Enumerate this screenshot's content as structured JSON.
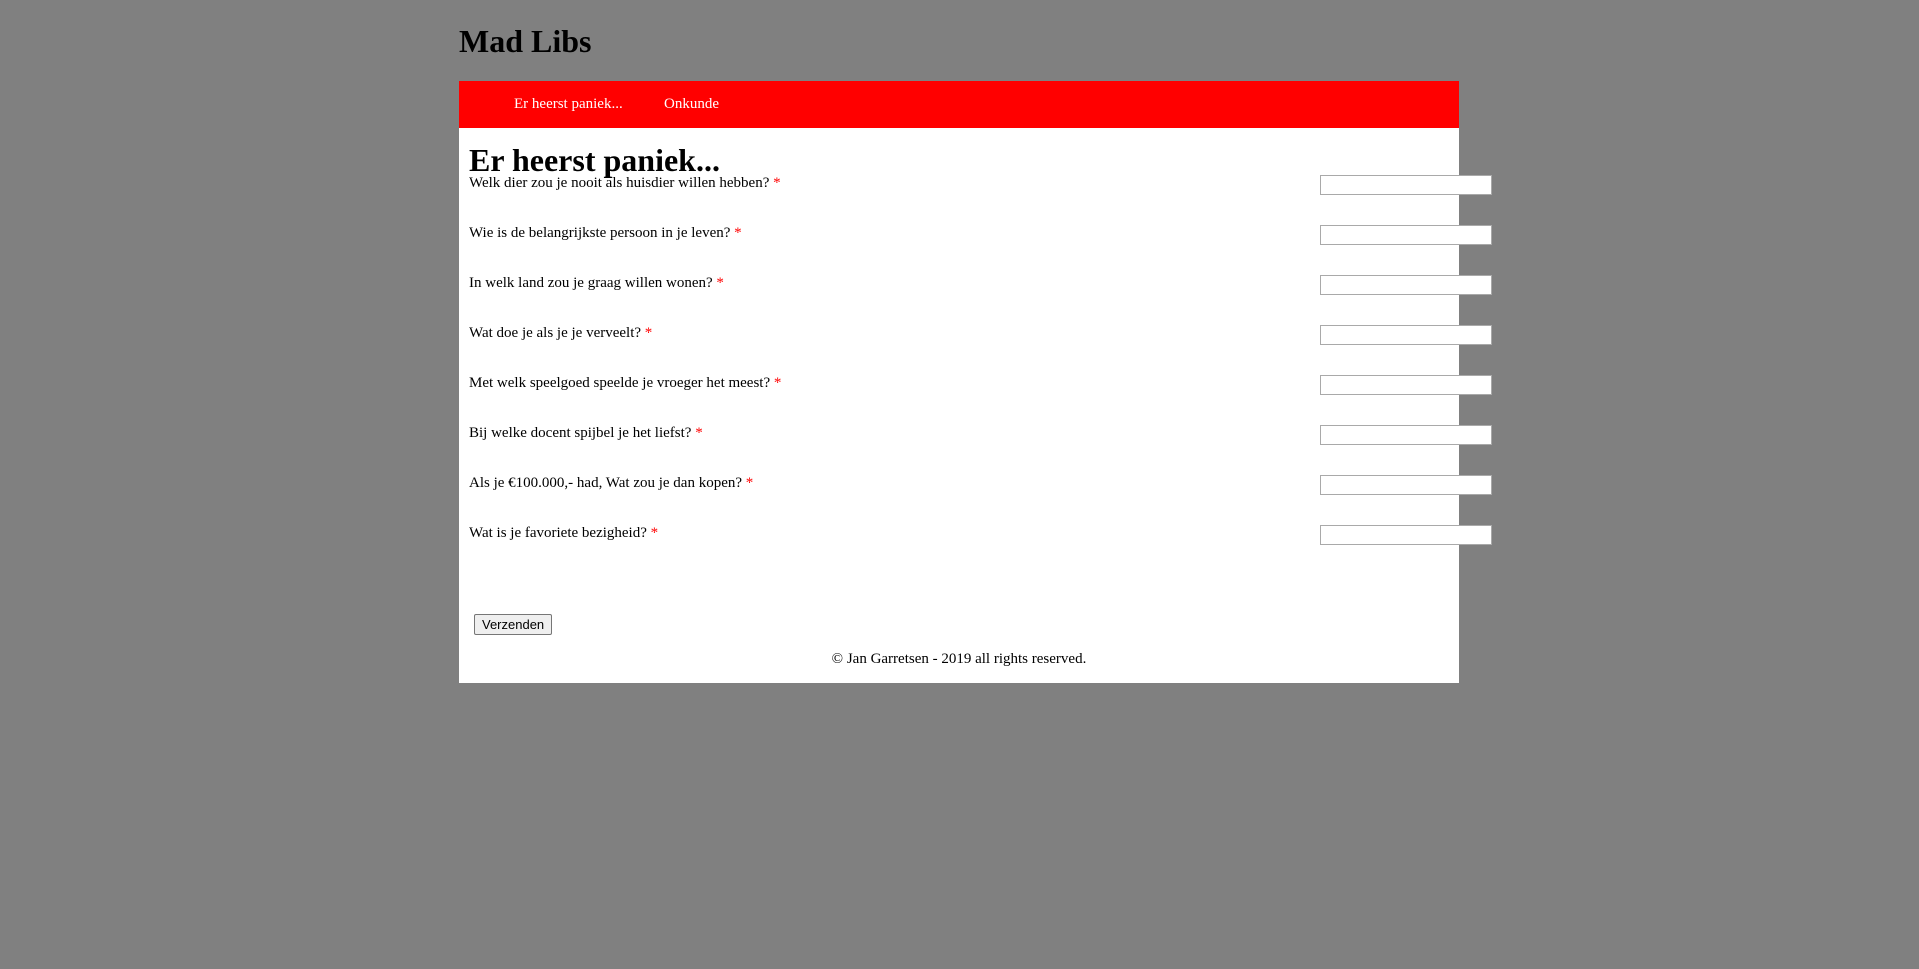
{
  "site": {
    "title": "Mad Libs"
  },
  "nav": {
    "items": [
      {
        "label": "Er heerst paniek..."
      },
      {
        "label": "Onkunde"
      }
    ]
  },
  "main": {
    "heading": "Er heerst paniek...",
    "required_marker": "*",
    "fields": [
      {
        "label": "Welk dier zou je nooit als huisdier willen hebben?",
        "value": ""
      },
      {
        "label": "Wie is de belangrijkste persoon in je leven?",
        "value": ""
      },
      {
        "label": "In welk land zou je graag willen wonen?",
        "value": ""
      },
      {
        "label": "Wat doe je als je je verveelt?",
        "value": ""
      },
      {
        "label": "Met welk speelgoed speelde je vroeger het meest?",
        "value": ""
      },
      {
        "label": "Bij welke docent spijbel je het liefst?",
        "value": ""
      },
      {
        "label": "Als je €100.000,- had, Wat zou je dan kopen?",
        "value": ""
      },
      {
        "label": "Wat is je favoriete bezigheid?",
        "value": ""
      }
    ],
    "submit_label": "Verzenden"
  },
  "footer": {
    "text": "© Jan Garretsen - 2019 all rights reserved."
  },
  "colors": {
    "page_background": "#808080",
    "nav_background": "#ff0000",
    "nav_text": "#ffffff",
    "content_background": "#ffffff",
    "required_marker": "#ff0000"
  }
}
